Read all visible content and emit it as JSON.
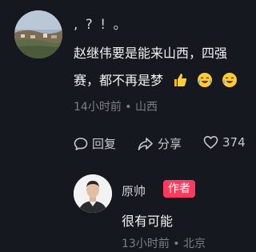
{
  "comment": {
    "author": ", ? ! 。",
    "text_line1": "赵继伟要是能来山西，四强",
    "text_line2": "赛，都不再是梦",
    "emojis": [
      "thumbs-up-icon",
      "crying-laugh-icon",
      "crying-laugh-icon"
    ],
    "time": "14小时前",
    "location": "山西",
    "actions": {
      "reply": "回复",
      "share": "分享",
      "likes": "374"
    }
  },
  "reply": {
    "author": "原帅",
    "badge": "作者",
    "text": "很有可能",
    "time": "13小时前",
    "location": "北京"
  },
  "colors": {
    "background": "#16181f",
    "badge": "#ff3a5c",
    "muted": "#7d7f86"
  }
}
